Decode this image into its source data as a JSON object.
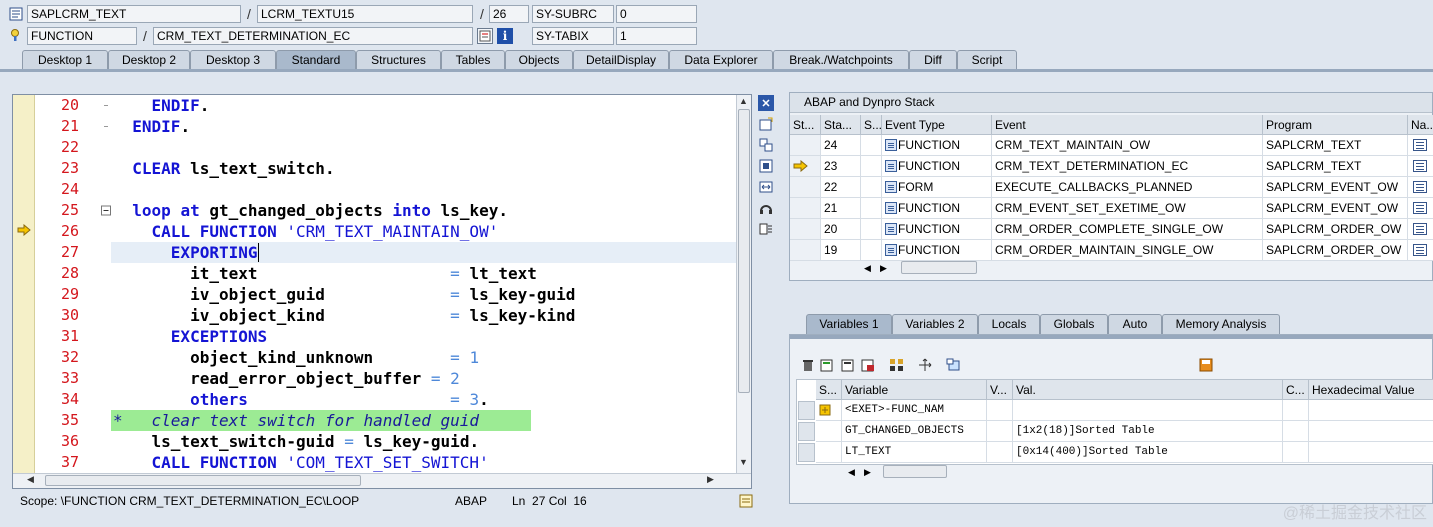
{
  "header": {
    "row1": {
      "program": "SAPLCRM_TEXT",
      "include": "LCRM_TEXTU15",
      "line": "26",
      "sysfield_label": "SY-SUBRC",
      "sysfield_value": "0"
    },
    "row2": {
      "type": "FUNCTION",
      "name": "CRM_TEXT_DETERMINATION_EC",
      "sysfield_label": "SY-TABIX",
      "sysfield_value": "1"
    },
    "separator": "/"
  },
  "tabs": [
    "Desktop 1",
    "Desktop 2",
    "Desktop 3",
    "Standard",
    "Structures",
    "Tables",
    "Objects",
    "DetailDisplay",
    "Data Explorer",
    "Break./Watchpoints",
    "Diff",
    "Script"
  ],
  "active_tab": "Standard",
  "editor": {
    "lines": [
      {
        "no": "20",
        "text": "    ENDIF."
      },
      {
        "no": "21",
        "text": "  ENDIF."
      },
      {
        "no": "22",
        "text": ""
      },
      {
        "no": "23",
        "text": "  CLEAR ls_text_switch."
      },
      {
        "no": "24",
        "text": ""
      },
      {
        "no": "25",
        "text": "  loop at gt_changed_objects into ls_key."
      },
      {
        "no": "26",
        "text": "    CALL FUNCTION 'CRM_TEXT_MAINTAIN_OW'"
      },
      {
        "no": "27",
        "text": "      EXPORTING"
      },
      {
        "no": "28",
        "text": "        it_text                    = lt_text"
      },
      {
        "no": "29",
        "text": "        iv_object_guid             = ls_key-guid"
      },
      {
        "no": "30",
        "text": "        iv_object_kind             = ls_key-kind"
      },
      {
        "no": "31",
        "text": "      EXCEPTIONS"
      },
      {
        "no": "32",
        "text": "        object_kind_unknown        = 1"
      },
      {
        "no": "33",
        "text": "        read_error_object_buffer = 2"
      },
      {
        "no": "34",
        "text": "        others                     = 3."
      },
      {
        "no": "35",
        "text": "*   clear text switch for handled guid"
      },
      {
        "no": "36",
        "text": "    ls_text_switch-guid = ls_key-guid."
      },
      {
        "no": "37",
        "text": "    CALL FUNCTION 'COM_TEXT_SET_SWITCH'"
      }
    ],
    "current_line": "26",
    "cursor_line": "27",
    "comment_line": "35"
  },
  "status": {
    "scope": "Scope: \\FUNCTION CRM_TEXT_DETERMINATION_EC\\LOOP",
    "language": "ABAP",
    "position": "Ln  27 Col  16"
  },
  "stack": {
    "title": "ABAP and Dynpro Stack",
    "columns": [
      "St...",
      "Sta...",
      "S...",
      "Event Type",
      "Event",
      "Program",
      "Na..."
    ],
    "rows": [
      {
        "level": "24",
        "type": "FUNCTION",
        "event": "CRM_TEXT_MAINTAIN_OW",
        "program": "SAPLCRM_TEXT",
        "current": false
      },
      {
        "level": "23",
        "type": "FUNCTION",
        "event": "CRM_TEXT_DETERMINATION_EC",
        "program": "SAPLCRM_TEXT",
        "current": true
      },
      {
        "level": "22",
        "type": "FORM",
        "event": "EXECUTE_CALLBACKS_PLANNED",
        "program": "SAPLCRM_EVENT_OW",
        "current": false
      },
      {
        "level": "21",
        "type": "FUNCTION",
        "event": "CRM_EVENT_SET_EXETIME_OW",
        "program": "SAPLCRM_EVENT_OW",
        "current": false
      },
      {
        "level": "20",
        "type": "FUNCTION",
        "event": "CRM_ORDER_COMPLETE_SINGLE_OW",
        "program": "SAPLCRM_ORDER_OW",
        "current": false
      },
      {
        "level": "19",
        "type": "FUNCTION",
        "event": "CRM_ORDER_MAINTAIN_SINGLE_OW",
        "program": "SAPLCRM_ORDER_OW",
        "current": false
      }
    ]
  },
  "var_tabs": [
    "Variables 1",
    "Variables 2",
    "Locals",
    "Globals",
    "Auto",
    "Memory Analysis"
  ],
  "active_var_tab": "Variables 1",
  "variables": {
    "columns": [
      "S...",
      "Variable",
      "V...",
      "Val.",
      "C...",
      "Hexadecimal Value"
    ],
    "rows": [
      {
        "name": "<EXET>-FUNC_NAM",
        "value": ""
      },
      {
        "name": "GT_CHANGED_OBJECTS",
        "value": "[1x2(18)]Sorted Table"
      },
      {
        "name": "LT_TEXT",
        "value": "[0x14(400)]Sorted Table"
      }
    ]
  },
  "watermark": "@稀土掘金技术社区",
  "colors": {
    "line_numbers": "#d4161c",
    "keyword": "#1414d4",
    "comment_bg": "#9ceb94",
    "gutter": "#f5f0c8"
  }
}
